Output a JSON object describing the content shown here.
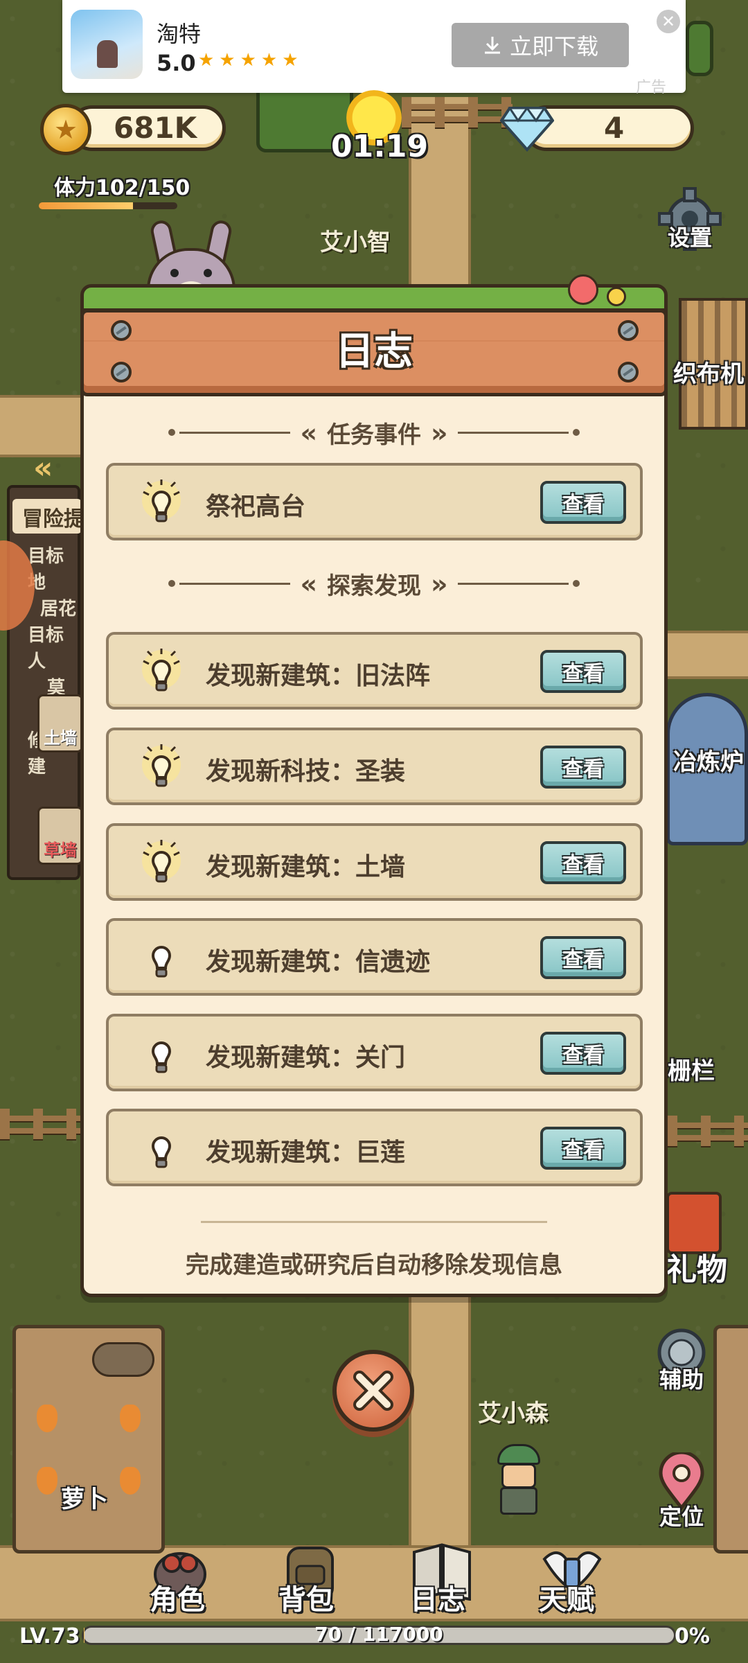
{
  "ad": {
    "app_name": "淘特",
    "rating": "5.0",
    "stars": "★★★★★",
    "download_label": "立即下载",
    "close_glyph": "✕",
    "tag": "广告"
  },
  "hud": {
    "coins": "681K",
    "timer": "01:19",
    "gems": "4",
    "stamina_label": "体力102/150",
    "stamina_fraction": 0.68
  },
  "world": {
    "npc_top": "艾小智",
    "npc_bottom": "艾小森",
    "buildings": {
      "loom": "织布机",
      "furnace": "冶炼炉",
      "fence": "栅栏",
      "gift": "礼物",
      "carrot": "萝卜"
    },
    "left_panel": {
      "title": "冒险提",
      "lines": [
        "目标地",
        "居花",
        "目标人",
        "莫叫",
        "修整建"
      ],
      "slot1": "土墙",
      "slot2": "草墙"
    }
  },
  "side_buttons": {
    "settings": "设置",
    "assist": "辅助",
    "locate": "定位"
  },
  "dialog": {
    "title": "日志",
    "section_tasks": "任务事件",
    "section_explore": "探索发现",
    "view_label": "查看",
    "tasks": [
      {
        "text": "祭祀高台",
        "lit": true
      }
    ],
    "discoveries": [
      {
        "text": "发现新建筑：旧法阵",
        "lit": true
      },
      {
        "text": "发现新科技：圣装",
        "lit": true
      },
      {
        "text": "发现新建筑：土墙",
        "lit": true
      },
      {
        "text": "发现新建筑：信遗迹",
        "lit": false
      },
      {
        "text": "发现新建筑：关门",
        "lit": false
      },
      {
        "text": "发现新建筑：巨莲",
        "lit": false
      }
    ],
    "footer": "完成建造或研究后自动移除发现信息"
  },
  "nav": {
    "character": "角色",
    "backpack": "背包",
    "journal": "日志",
    "talent": "天赋"
  },
  "level": {
    "label": "LV.73",
    "xp": "70 / 117000",
    "percent": "0%",
    "fraction": 0.0006
  },
  "colors": {
    "dialog_bg": "#fbeed8",
    "board": "#dc8f62",
    "view_button": "#9ed2d2",
    "grass": "#535f2e"
  }
}
